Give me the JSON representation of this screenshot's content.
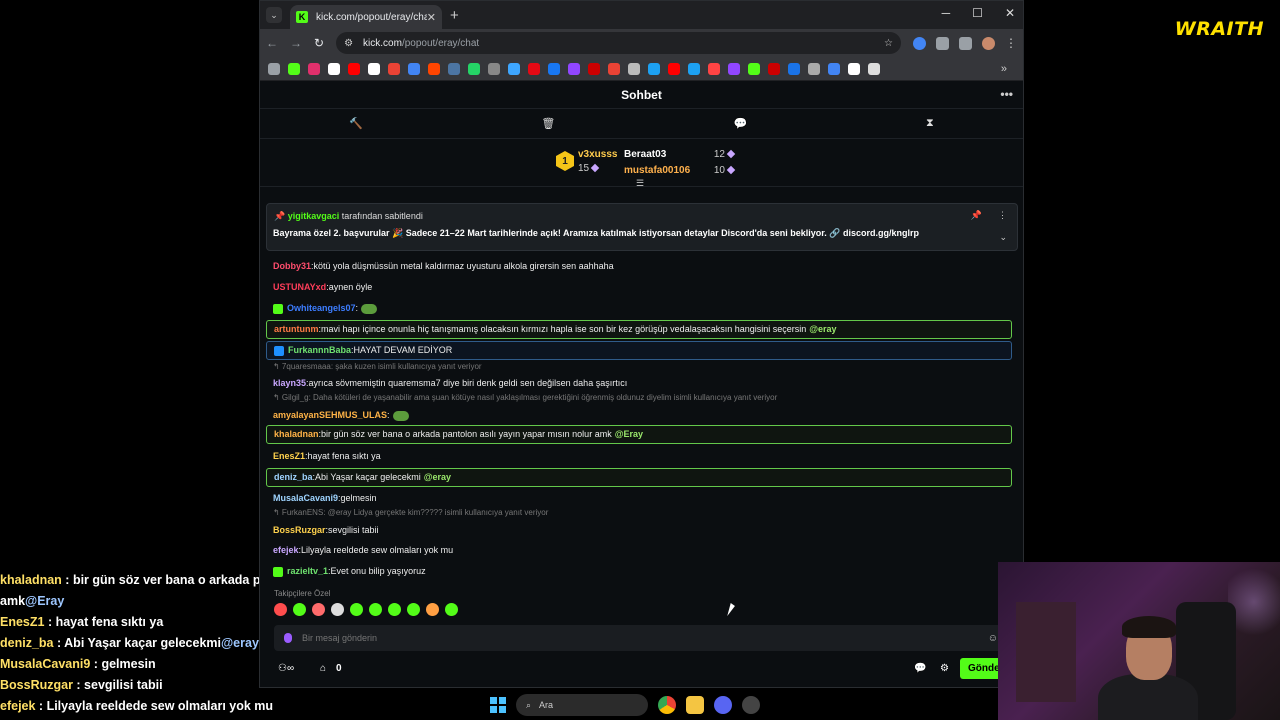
{
  "overlay": {
    "logo": "WRAITH",
    "messages": [
      {
        "user": "khaladnan",
        "text": "bir gün söz ver bana o arkada pantolon",
        "mention": ""
      },
      {
        "user": "",
        "text": "amk",
        "mention": "@Eray"
      },
      {
        "user": "EnesZ1",
        "text": "hayat fena sıktı ya",
        "mention": ""
      },
      {
        "user": "deniz_ba",
        "text": "Abi Yaşar kaçar gelecekmi",
        "mention": "@eray"
      },
      {
        "user": "MusalaCavani9",
        "text": "gelmesin",
        "mention": ""
      },
      {
        "user": "BossRuzgar",
        "text": "sevgilisi tabii",
        "mention": ""
      },
      {
        "user": "efejek",
        "text": "Lilyayla reeldede sew olmaları yok mu",
        "mention": ""
      }
    ]
  },
  "browser": {
    "tab_title": "kick.com/popout/eray/chat",
    "favicon": "K",
    "url_host": "kick.com",
    "url_path": "/popout/eray/chat",
    "bookmark_colors": [
      "#53fc18",
      "#e1306c",
      "#ffffff",
      "#ff0000",
      "#ffffff",
      "#ea4335",
      "#4285f4",
      "#ff4500",
      "#4c75a3",
      "#25d366",
      "#888888",
      "#3ea6ff",
      "#e50914",
      "#1877f2",
      "#9146ff",
      "#cc0000",
      "#ea4335",
      "#bbbbbb",
      "#1da1f2",
      "#ff0000",
      "#1da1f2",
      "#ff4444",
      "#9146ff",
      "#53fc18",
      "#cc0000",
      "#1a73e8",
      "#aaaaaa",
      "#4285f4",
      "#ffffff",
      "#dddddd"
    ]
  },
  "chat": {
    "title": "Sohbet",
    "leaderboard": {
      "first": {
        "rank": "1",
        "name": "v3xusss",
        "points": "15"
      },
      "rows": [
        {
          "name": "Beraat03",
          "points": "12",
          "color": "#ffffff"
        },
        {
          "name": "mustafa00106",
          "points": "10",
          "color": "#ffb14d"
        }
      ]
    },
    "pinned": {
      "pinned_by": "yigitkavgaci",
      "pinned_suffix": "tarafından sabitlendi",
      "text": "Bayrama özel 2. başvurular 🎉 Sadece 21–22 Mart tarihlerinde açık! Aramıza katılmak istiyorsan detaylar Discord'da seni bekliyor. 🔗 discord.gg/knglrp"
    },
    "messages": [
      {
        "user": "Dobby31",
        "color": "#ff4d6d",
        "text": "kötü yola düşmüssün metal kaldırmaz uyusturu alkola girersin sen aahhaha",
        "mention": "",
        "style": ""
      },
      {
        "user": "USTUNAYxd",
        "color": "#ff3d5a",
        "text": "aynen öyle",
        "mention": "",
        "style": ""
      },
      {
        "user": "Owhiteangels07",
        "color": "#3d7dff",
        "text": "",
        "mention": "",
        "style": ""
      },
      {
        "user": "artuntunm",
        "color": "#ff7a45",
        "text": "mavi hapı içince onunla hiç tanışmamış olacaksın kırmızı hapla ise son bir kez görüşüp vedalaşacaksın hangisini seçersin",
        "mention": "@eray",
        "style": "hl"
      },
      {
        "user": "FurkannnBaba",
        "color": "#6fe26f",
        "text": "HAYAT DEVAM EDİYOR",
        "mention": "",
        "style": "hl-blue"
      },
      {
        "user": "klayn35",
        "color": "#c9a7ff",
        "text": "ayrıca sövmemiştin quaremsma7 diye biri denk geldi sen değilsen daha şaşırtıcı",
        "mention": "",
        "style": ""
      },
      {
        "user": "amyalayanSEHMUS_ULAS",
        "color": "#ffb347",
        "text": "",
        "mention": "",
        "style": ""
      },
      {
        "user": "khaladnan",
        "color": "#ffb347",
        "text": "bir gün söz ver bana o arkada pantolon asılı yayın yapar mısın nolur amk",
        "mention": "@Eray",
        "style": "hl"
      },
      {
        "user": "EnesZ1",
        "color": "#ffd24d",
        "text": "hayat fena sıktı ya",
        "mention": "",
        "style": ""
      },
      {
        "user": "deniz_ba",
        "color": "#9fd4ff",
        "text": "Abi Yaşar kaçar gelecekmi",
        "mention": "@eray",
        "style": "hl"
      },
      {
        "user": "MusalaCavani9",
        "color": "#9fd4ff",
        "text": "gelmesin",
        "mention": "",
        "style": ""
      },
      {
        "user": "BossRuzgar",
        "color": "#ffd24d",
        "text": "sevgilisi tabii",
        "mention": "",
        "style": ""
      },
      {
        "user": "efejek",
        "color": "#c9a7ff",
        "text": "Lilyayla reeldede sew olmaları yok mu",
        "mention": "",
        "style": ""
      },
      {
        "user": "razieltv_1",
        "color": "#6fe26f",
        "text": "Evet onu bilip yaşıyoruz",
        "mention": "",
        "style": ""
      }
    ],
    "replies": [
      {
        "text": "7quaresmaaa: şaka kuzen isimli kullanıcıya yanıt veriyor"
      },
      {
        "text": "Gilgil_g: Daha kötüleri de yaşanabilir ama şuan kötüye nasıl yaklaşılması gerektiğini öğrenmiş oldunuz diyelim isimli kullanıcıya yanıt veriyor"
      },
      {
        "text": "FurkanENS: @eray Lidya gerçekte kim????? isimli kullanıcıya yanıt veriyor"
      }
    ],
    "followers_only": "Takipçilere Özel",
    "input_placeholder": "Bir mesaj gönderin",
    "points_count": "0",
    "send_label": "Gönder"
  },
  "taskbar": {
    "search_label": "Ara"
  }
}
